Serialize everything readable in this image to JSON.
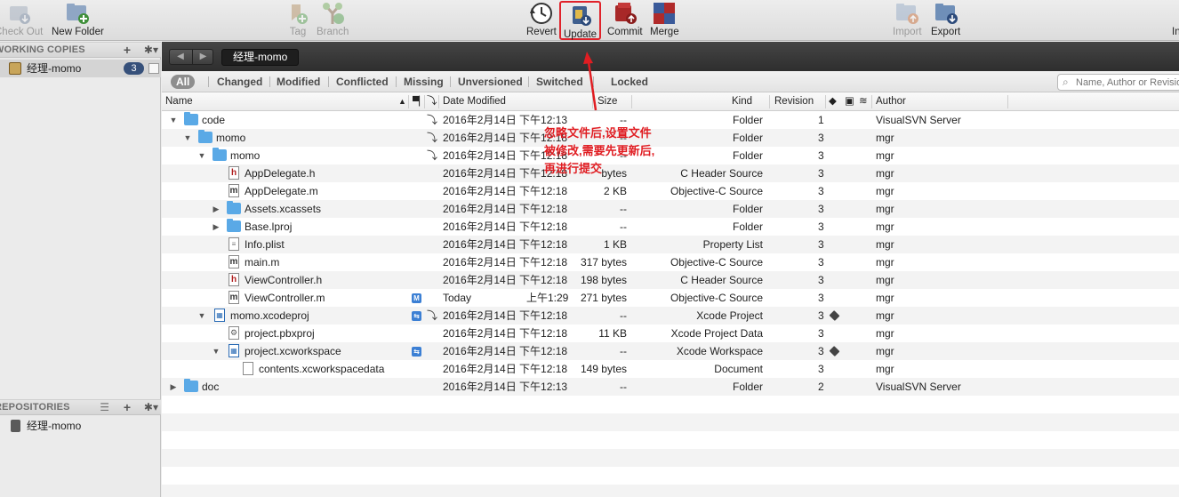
{
  "toolbar": {
    "check_out": "Check Out",
    "new_folder": "New Folder",
    "tag": "Tag",
    "branch": "Branch",
    "revert": "Revert",
    "update": "Update",
    "commit": "Commit",
    "merge": "Merge",
    "import": "Import",
    "export": "Export",
    "info": "In"
  },
  "sidebar": {
    "working_copies_header": "WORKING COPIES",
    "working_copies": [
      {
        "label": "经理-momo",
        "count": "3"
      }
    ],
    "repositories_header": "REPOSITORIES",
    "repositories": [
      {
        "label": "经理-momo"
      }
    ],
    "plus": "+",
    "gear": "✱▾",
    "lines": "☰"
  },
  "pathbar": {
    "back": "◀",
    "forward": "▶",
    "current": "经理-momo"
  },
  "filters": {
    "all": "All",
    "changed": "Changed",
    "modified": "Modified",
    "conflicted": "Conflicted",
    "missing": "Missing",
    "unversioned": "Unversioned",
    "switched": "Switched",
    "locked": "Locked"
  },
  "search": {
    "placeholder": "Name, Author or Revision"
  },
  "table": {
    "headers": {
      "name": "Name",
      "date_modified": "Date Modified",
      "size": "Size",
      "kind": "Kind",
      "revision": "Revision",
      "author": "Author"
    },
    "rows": [
      {
        "name": "code",
        "date": "2016年2月14日 下午12:13",
        "size": "--",
        "kind": "Folder",
        "rev": "1",
        "author": "VisualSVN Server"
      },
      {
        "name": "momo",
        "date": "2016年2月14日 下午12:18",
        "size": "--",
        "kind": "Folder",
        "rev": "3",
        "author": "mgr"
      },
      {
        "name": "momo",
        "date": "2016年2月14日 下午12:18",
        "size": "--",
        "kind": "Folder",
        "rev": "3",
        "author": "mgr"
      },
      {
        "name": "AppDelegate.h",
        "date": "2016年2月14日 下午12:18",
        "size": "bytes",
        "kind": "C Header Source",
        "rev": "3",
        "author": "mgr"
      },
      {
        "name": "AppDelegate.m",
        "date": "2016年2月14日 下午12:18",
        "size": "2 KB",
        "kind": "Objective-C Source",
        "rev": "3",
        "author": "mgr"
      },
      {
        "name": "Assets.xcassets",
        "date": "2016年2月14日 下午12:18",
        "size": "--",
        "kind": "Folder",
        "rev": "3",
        "author": "mgr"
      },
      {
        "name": "Base.lproj",
        "date": "2016年2月14日 下午12:18",
        "size": "--",
        "kind": "Folder",
        "rev": "3",
        "author": "mgr"
      },
      {
        "name": "Info.plist",
        "date": "2016年2月14日 下午12:18",
        "size": "1 KB",
        "kind": "Property List",
        "rev": "3",
        "author": "mgr"
      },
      {
        "name": "main.m",
        "date": "2016年2月14日 下午12:18",
        "size": "317 bytes",
        "kind": "Objective-C Source",
        "rev": "3",
        "author": "mgr"
      },
      {
        "name": "ViewController.h",
        "date": "2016年2月14日 下午12:18",
        "size": "198 bytes",
        "kind": "C Header Source",
        "rev": "3",
        "author": "mgr"
      },
      {
        "name": "ViewController.m",
        "date": "Today",
        "time": "上午1:29",
        "size": "271 bytes",
        "kind": "Objective-C Source",
        "rev": "3",
        "author": "mgr",
        "status": "M"
      },
      {
        "name": "momo.xcodeproj",
        "date": "2016年2月14日 下午12:18",
        "size": "--",
        "kind": "Xcode Project",
        "rev": "3",
        "author": "mgr"
      },
      {
        "name": "project.pbxproj",
        "date": "2016年2月14日 下午12:18",
        "size": "11 KB",
        "kind": "Xcode Project Data",
        "rev": "3",
        "author": "mgr"
      },
      {
        "name": "project.xcworkspace",
        "date": "2016年2月14日 下午12:18",
        "size": "--",
        "kind": "Xcode Workspace",
        "rev": "3",
        "author": "mgr"
      },
      {
        "name": "contents.xcworkspacedata",
        "date": "2016年2月14日 下午12:18",
        "size": "149 bytes",
        "kind": "Document",
        "rev": "3",
        "author": "mgr"
      },
      {
        "name": "doc",
        "date": "2016年2月14日 下午12:13",
        "size": "--",
        "kind": "Folder",
        "rev": "2",
        "author": "VisualSVN Server"
      }
    ]
  },
  "annotation": {
    "line1": "忽略文件后,设置文件",
    "line2": "被修改,需要先更新后,",
    "line3": "再进行提交",
    "color": "#e01d22"
  },
  "colors": {
    "accent": "#36507a",
    "folder": "#5aa9e6",
    "status_modified": "#3b7fd4"
  }
}
